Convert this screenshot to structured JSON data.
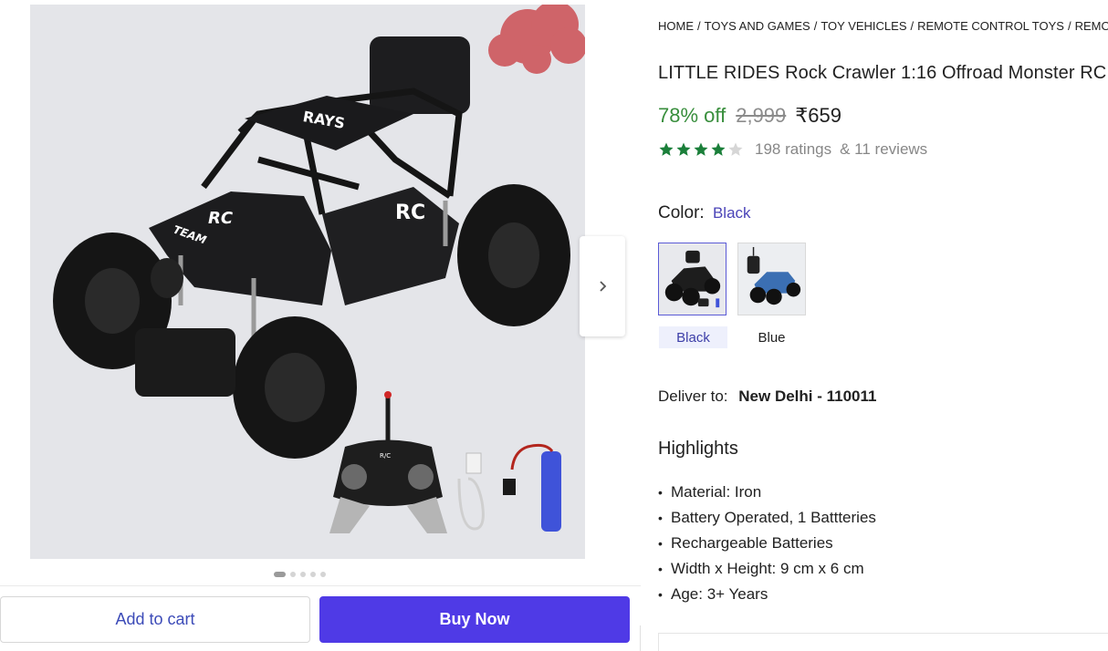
{
  "breadcrumb": [
    "HOME",
    "TOYS AND GAMES",
    "TOY VEHICLES",
    "REMOTE CONTROL TOYS",
    "REMOTE C"
  ],
  "product": {
    "title": "LITTLE RIDES Rock Crawler 1:16 Offroad Monster RC",
    "discount": "78% off",
    "mrp": "2,999",
    "price": "₹659",
    "rating_stars": 4,
    "ratings_count": "198 ratings",
    "reviews_count": "& 11 reviews"
  },
  "image_labels": {
    "roof_brand": "RAYS",
    "hood_badge": "RC",
    "hood_text": "TEAM",
    "side_badge": "RC",
    "remote_label": "R/C"
  },
  "gallery": {
    "dot_count": 5,
    "active_dot": 0
  },
  "color": {
    "label": "Color:",
    "selected": "Black",
    "options": [
      {
        "label": "Black",
        "selected": true,
        "hex": "#2b2b2b"
      },
      {
        "label": "Blue",
        "selected": false,
        "hex": "#3b6fb3"
      }
    ]
  },
  "delivery": {
    "label": "Deliver to:",
    "location": "New Delhi - 110011"
  },
  "highlights": {
    "title": "Highlights",
    "items": [
      "Material: Iron",
      "Battery Operated, 1 Battteries",
      "Rechargeable Batteries",
      "Width x Height: 9 cm x 6 cm",
      "Age: 3+ Years"
    ]
  },
  "actions": {
    "add_to_cart": "Add to cart",
    "buy_now": "Buy Now"
  },
  "colors": {
    "accent": "#4f3ae6",
    "discount_green": "#388e3c",
    "star_green": "#1b7f3a",
    "link_blue": "#4b44b8"
  },
  "icons": {
    "next": "chevron-right-icon",
    "star": "star-icon"
  }
}
